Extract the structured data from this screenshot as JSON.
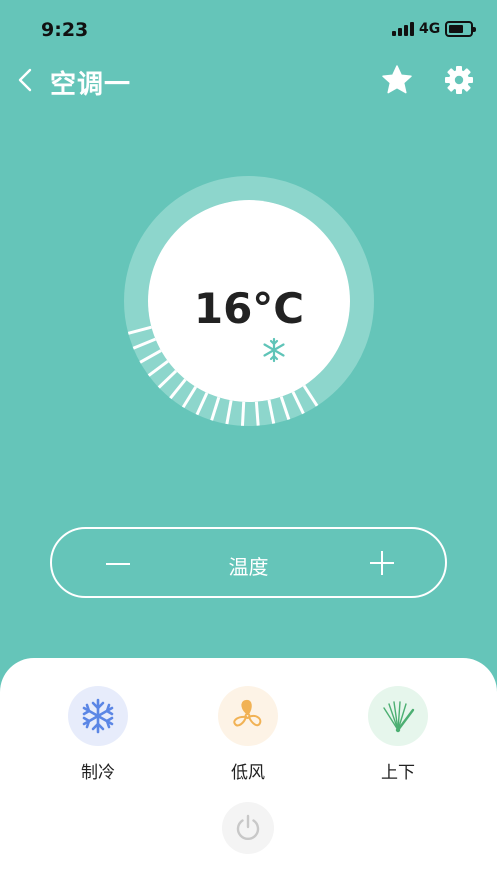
{
  "status_bar": {
    "time": "9:23",
    "network": "4G"
  },
  "nav": {
    "title": "空调一"
  },
  "thermostat": {
    "temperature": "16°C",
    "mode_icon": "snowflake-icon",
    "level": 0.3
  },
  "temp_control": {
    "label": "温度",
    "decrease_icon": "minus-icon",
    "increase_icon": "plus-icon"
  },
  "controls": [
    {
      "label": "制冷",
      "icon": "snowflake-icon"
    },
    {
      "label": "低风",
      "icon": "fan-icon"
    },
    {
      "label": "上下",
      "icon": "swing-icon"
    }
  ],
  "colors": {
    "background": "#65c5b9",
    "ring": "#8dd6cc",
    "cool": "#5b86e5",
    "fan": "#f1b255",
    "swing": "#4caf72",
    "power": "#c8c8c8"
  }
}
